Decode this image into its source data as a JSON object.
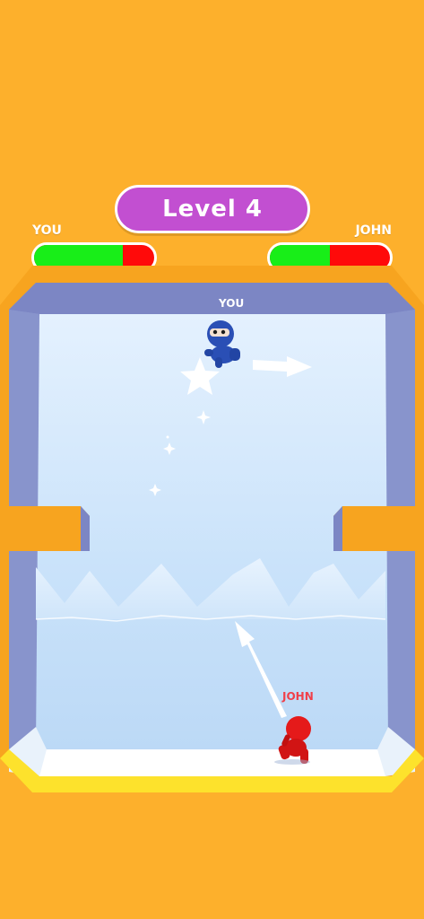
{
  "level": {
    "label": "Level 4"
  },
  "players": {
    "you": {
      "name": "YOU",
      "health": 0.74,
      "color": "#18ee18",
      "character_label": "YOU"
    },
    "opponent": {
      "name": "JOHN",
      "health": 0.5,
      "color": "#ff0a0a",
      "character_label": "JOHN"
    }
  },
  "colors": {
    "background": "#fdb02c",
    "level_pill": "#c24fd1",
    "health_full": "#18ee18",
    "health_lost": "#ff0a0a",
    "arena_inner": "#cfe6fb",
    "player_blue": "#2a4fb5",
    "opponent_red": "#e51a1a"
  }
}
